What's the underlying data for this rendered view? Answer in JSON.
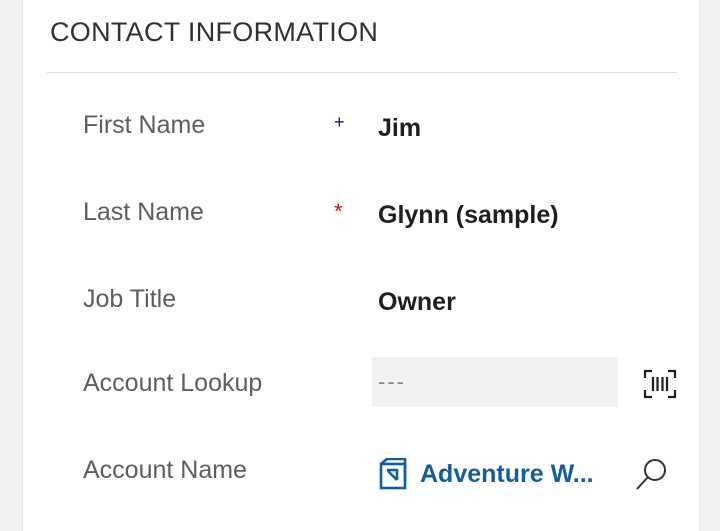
{
  "section": {
    "title": "CONTACT INFORMATION"
  },
  "fields": {
    "first_name": {
      "label": "First Name",
      "marker": "+",
      "value": "Jim"
    },
    "last_name": {
      "label": "Last Name",
      "marker": "*",
      "value": "Glynn (sample)"
    },
    "job_title": {
      "label": "Job Title",
      "value": "Owner"
    },
    "account_lookup": {
      "label": "Account Lookup",
      "placeholder": "---",
      "icon": "barcode-scan-icon"
    },
    "account_name": {
      "label": "Account Name",
      "value": "Adventure W...",
      "entity_icon": "account-entity-icon",
      "search_icon": "search-icon"
    }
  },
  "colors": {
    "label": "#605e5c",
    "value": "#201f1e",
    "link": "#115ea3",
    "recommended_marker": "#0000c0",
    "required_marker": "#c50f1f"
  }
}
